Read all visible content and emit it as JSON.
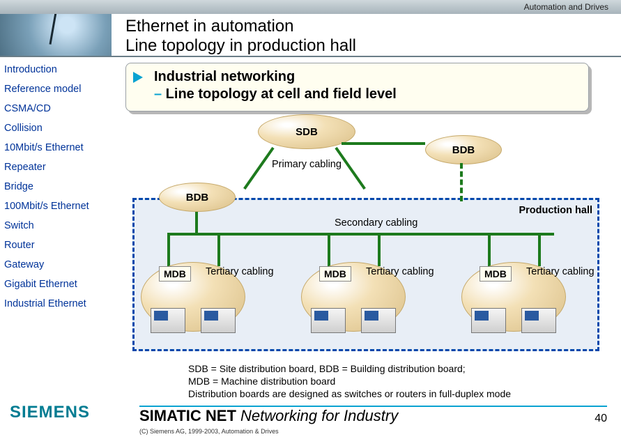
{
  "topbar": "Automation and Drives",
  "header": {
    "line1": "Ethernet in automation",
    "line2": "Line topology in production hall"
  },
  "sidebar": {
    "items": [
      "Introduction",
      "Reference model",
      "CSMA/CD",
      "Collision",
      "10Mbit/s Ethernet",
      "Repeater",
      "Bridge",
      "100Mbit/s Ethernet",
      "Switch",
      "Router",
      "Gateway",
      "Gigabit Ethernet",
      "Industrial Ethernet"
    ]
  },
  "callout": {
    "title": "Industrial networking",
    "dash": "–",
    "subtitle": " Line topology at cell and field level"
  },
  "diagram": {
    "sdb": "SDB",
    "bdb": "BDB",
    "mdb": "MDB",
    "primary": "Primary cabling",
    "secondary": "Secondary cabling",
    "tertiary": "Tertiary cabling",
    "hall": "Production hall"
  },
  "footnote": {
    "l1": "SDB = Site distribution board, BDB = Building distribution board;",
    "l2": "MDB = Machine distribution board",
    "l3": "Distribution boards are designed as switches or routers in full-duplex mode"
  },
  "footer": {
    "brand": "SIEMENS",
    "title_bold": "SIMATIC NET",
    "title_rest": " Networking for Industry",
    "copyright": "(C) Siemens AG, 1999-2003, Automation & Drives",
    "page": "40"
  }
}
